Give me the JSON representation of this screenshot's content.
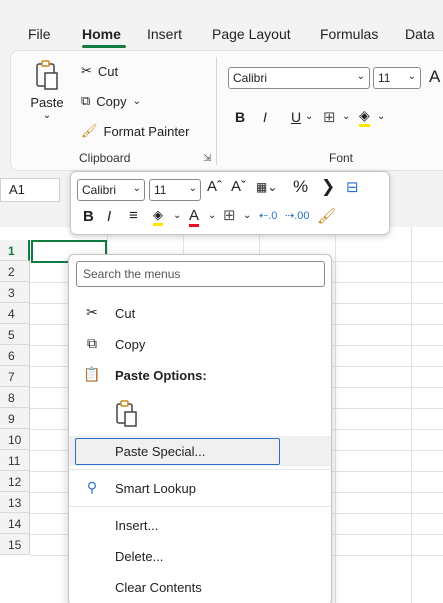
{
  "tabs": [
    "File",
    "Home",
    "Insert",
    "Page Layout",
    "Formulas",
    "Data"
  ],
  "ribbon": {
    "paste_label": "Paste",
    "cut_label": "Cut",
    "copy_label": "Copy",
    "format_painter_label": "Format Painter",
    "clipboard_group": "Clipboard",
    "font_group": "Font",
    "font_name": "Calibri",
    "font_size": "11",
    "bold": "B",
    "italic": "I",
    "underline": "U"
  },
  "namebox": "A1",
  "mini_toolbar": {
    "font_name": "Calibri",
    "font_size": "11",
    "grow": "Aˆ",
    "shrink": "Aˇ",
    "percent": "%",
    "comma": ")",
    "bold": "B",
    "italic": "I"
  },
  "rows": [
    "1",
    "2",
    "3",
    "4",
    "5",
    "6",
    "7",
    "8",
    "9",
    "10",
    "11",
    "12",
    "13",
    "14",
    "15"
  ],
  "context_menu": {
    "search_placeholder": "Search the menus",
    "items": [
      {
        "label": "Cut",
        "icon": "scissors-icon"
      },
      {
        "label": "Copy",
        "icon": "copy-icon"
      },
      {
        "label": "Paste Options:",
        "icon": "paste-icon"
      },
      {
        "label": "Paste Special...",
        "icon": ""
      },
      {
        "label": "Smart Lookup",
        "icon": "search-icon"
      },
      {
        "label": "Insert...",
        "icon": ""
      },
      {
        "label": "Delete...",
        "icon": ""
      },
      {
        "label": "Clear Contents",
        "icon": ""
      }
    ]
  },
  "colors": {
    "accent": "#107c41",
    "focus": "#2a6fc9",
    "font_color": "#e81123",
    "highlight": "#ffe600"
  }
}
